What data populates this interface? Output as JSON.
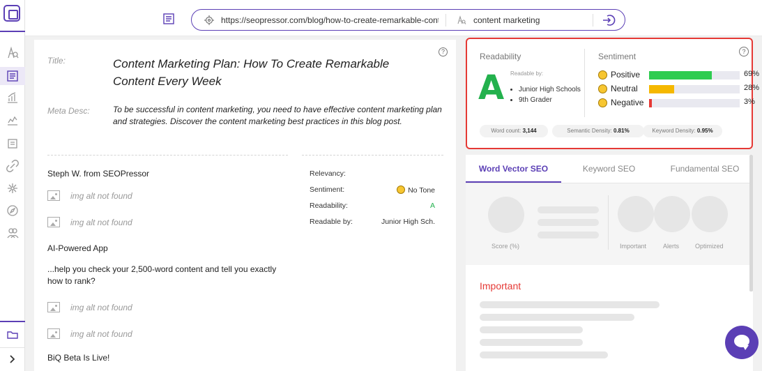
{
  "search": {
    "url": "https://seopressor.com/blog/how-to-create-remarkable-content",
    "keyword": "content marketing"
  },
  "page": {
    "title_label": "Title:",
    "title": "Content Marketing Plan: How To Create Remarkable Content Every Week",
    "meta_label": "Meta Desc:",
    "meta": "To be successful in content marketing, you need to have effective content marketing plan and strategies. Discover the content marketing best practices in this blog post.",
    "help_icon": "?"
  },
  "content": {
    "author": "Steph W. from SEOPressor",
    "img_alt_1": "img alt not found",
    "img_alt_2": "img alt not found",
    "heading_app": "AI-Powered App",
    "paragraph": "...help you check your 2,500-word content and tell you exactly how to rank?",
    "img_alt_3": "img alt not found",
    "img_alt_4": "img alt not found",
    "beta": "BiQ Beta Is Live!"
  },
  "stats": {
    "relevancy_label": "Relevancy:",
    "sentiment_label": "Sentiment:",
    "sentiment_value": "No Tone",
    "readability_label": "Readability:",
    "readability_value": "A",
    "readable_by_label": "Readable by:",
    "readable_by_value": "Junior High Sch."
  },
  "readability": {
    "title": "Readability",
    "grade": "A",
    "readable_by_label": "Readable by:",
    "levels": [
      "Junior High Schools",
      "9th Grader"
    ]
  },
  "sentiment": {
    "title": "Sentiment",
    "rows": [
      {
        "label": "Positive",
        "percent": 69,
        "text": "69%",
        "color": "#2ecc50"
      },
      {
        "label": "Neutral",
        "percent": 28,
        "text": "28%",
        "color": "#f5b800"
      },
      {
        "label": "Negative",
        "percent": 3,
        "text": "3%",
        "color": "#e53935"
      }
    ]
  },
  "metrics": {
    "word_count_label": "Word count:",
    "word_count": "3,144",
    "semantic_label": "Semantic Density:",
    "semantic": "0.81%",
    "keyword_label": "Keyword Density:",
    "keyword": "0.95%"
  },
  "seo": {
    "tabs": [
      "Word Vector SEO",
      "Keyword SEO",
      "Fundamental SEO"
    ],
    "active_tab": 0,
    "score_label": "Score (%)",
    "important_label": "Important",
    "alerts_label": "Alerts",
    "optimized_label": "Optimized",
    "important_heading": "Important"
  },
  "colors": {
    "accent": "#5b3fb5",
    "highlight": "#e53935",
    "grade": "#23b14d"
  }
}
